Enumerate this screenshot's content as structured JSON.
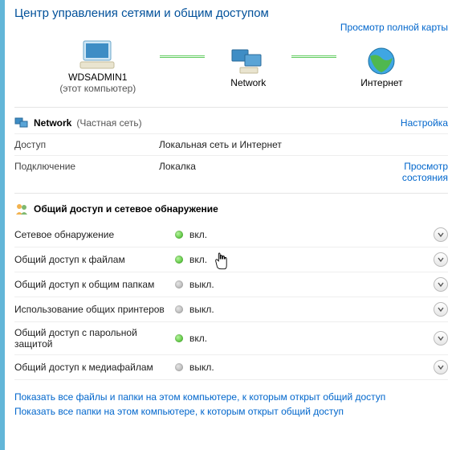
{
  "title": "Центр управления сетями и общим доступом",
  "view_full_map": "Просмотр полной карты",
  "map": {
    "node1_name": "WDSADMIN1",
    "node1_sub": "(этот компьютер)",
    "node2_name": "Network",
    "node3_name": "Интернет"
  },
  "network_section": {
    "name": "Network",
    "paren": "(Частная сеть)",
    "customize": "Настройка",
    "rows": {
      "access_label": "Доступ",
      "access_value": "Локальная сеть и Интернет",
      "conn_label": "Подключение",
      "conn_value": "Локалка",
      "conn_link": "Просмотр состояния"
    }
  },
  "sharing_section": {
    "title": "Общий доступ и сетевое обнаружение",
    "items": [
      {
        "label": "Сетевое обнаружение",
        "status": "вкл.",
        "on": true
      },
      {
        "label": "Общий доступ к файлам",
        "status": "вкл.",
        "on": true
      },
      {
        "label": "Общий доступ к общим папкам",
        "status": "выкл.",
        "on": false
      },
      {
        "label": "Использование общих принтеров",
        "status": "выкл.",
        "on": false
      },
      {
        "label": "Общий доступ с парольной защитой",
        "status": "вкл.",
        "on": true
      },
      {
        "label": "Общий доступ к медиафайлам",
        "status": "выкл.",
        "on": false
      }
    ]
  },
  "footer": {
    "link1": "Показать все файлы и папки на этом компьютере, к которым открыт общий доступ",
    "link2": "Показать все папки на этом компьютере, к которым открыт общий доступ"
  }
}
